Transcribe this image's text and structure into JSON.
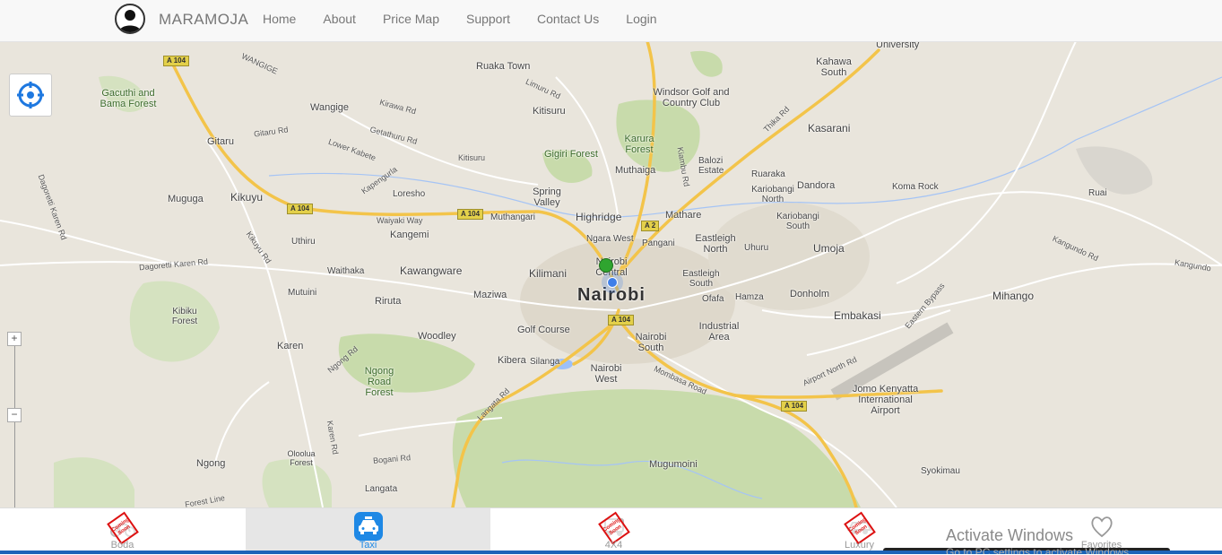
{
  "navbar": {
    "brand": "MARAMOJA",
    "links": [
      "Home",
      "About",
      "Price Map",
      "Support",
      "Contact Us",
      "Login"
    ]
  },
  "map": {
    "city_label": "Nairobi",
    "places": [
      "Gacuthi and Bama Forest",
      "Ruaka Town",
      "Wangige",
      "Gitaru",
      "Kitisuru",
      "Karura Forest",
      "Windsor Golf and Country Club",
      "Kahawa South",
      "University",
      "Kasarani",
      "Muthaiga",
      "Gigiri Forest",
      "Balozi Estate",
      "Ruaraka",
      "Kariobangi North",
      "Dandora",
      "Koma Rock",
      "Ruai",
      "Muguga",
      "Kikuyu",
      "Loresho",
      "Spring Valley",
      "Highridge",
      "Mathare",
      "Eastleigh North",
      "Kariobangi South",
      "Umoja",
      "Kangemi",
      "Muthangari",
      "Ngara West",
      "Pangani",
      "Uthiru",
      "Waithaka",
      "Kawangware",
      "Kilimani",
      "Nairobi Central",
      "Eastleigh South",
      "Uhuru",
      "Mutuini",
      "Riruta",
      "Maziwa",
      "Ofafa",
      "Hamza",
      "Donholm",
      "Mihango",
      "Kibiku Forest",
      "Embakasi",
      "Industrial Area",
      "Karen",
      "Woodley",
      "Golf Course",
      "Nairobi South",
      "Ngong Road Forest",
      "Kibera",
      "Silanga",
      "Nairobi West",
      "Jomo Kenyatta International Airport",
      "Ngong",
      "Oloolua Forest",
      "Langata",
      "Mugumoini",
      "Syokimau"
    ],
    "roads": [
      "Limuru Rd",
      "Kiambu Rd",
      "Thika Rd",
      "Gitaru Rd",
      "Kirawa Rd",
      "Getathuru Rd",
      "Lower Kabete",
      "Kitisuru",
      "Kapengurla",
      "Waiyaki Way",
      "Dagoretti Karen Rd",
      "Kikuyu Rd",
      "Dagoretti Karen Rd",
      "Ngong Rd",
      "Langata Rd",
      "Mombasa Road",
      "Airport North Rd",
      "Eastern Bypass",
      "Kangundo Rd",
      "Karen Rd",
      "Bogani Rd",
      "Forest Line",
      "WANGIGE",
      "Kangundo"
    ],
    "shields": [
      "A 104",
      "A 104",
      "A 104",
      "A 2",
      "A 104",
      "A 104"
    ],
    "zoom_in": "+",
    "zoom_out": "−"
  },
  "tabs": [
    {
      "label": "Boda",
      "active": false,
      "stamp": "Coming Soon"
    },
    {
      "label": "Taxi",
      "active": true,
      "stamp": ""
    },
    {
      "label": "4X4",
      "active": false,
      "stamp": "Coming Soon"
    },
    {
      "label": "Luxury",
      "active": false,
      "stamp": "Coming Soon"
    },
    {
      "label": "Favorites",
      "active": false,
      "stamp": ""
    }
  ],
  "overlay": {
    "activate_title": "Activate Windows",
    "activate_sub": "Go to PC settings to activate Windows."
  },
  "colors": {
    "accent": "#1e88e5",
    "map_background": "#e9e5dc",
    "park": "#c8dbab",
    "highway": "#f3c44a",
    "marker_green": "#2fa52f",
    "marker_blue": "#3f7fe8",
    "stamp_red": "#dd1111"
  }
}
